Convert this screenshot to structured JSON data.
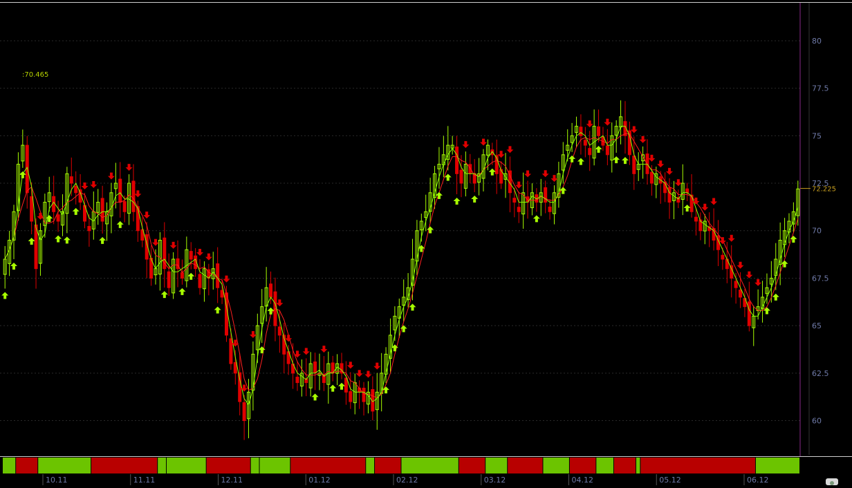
{
  "chart_data": {
    "type": "candlestick",
    "y_ticks": [
      "80",
      "77.5",
      "75",
      "72.5",
      "70",
      "67.5",
      "65",
      "62.5",
      "60"
    ],
    "ylim": [
      58.2,
      82.0
    ],
    "x_ticks": [
      "10.11",
      "11.11",
      "12.11",
      "01.12",
      "02.12",
      "03.12",
      "04.12",
      "05.12",
      "06.12"
    ],
    "last_price_label": "72.225",
    "last_price": 72.225,
    "marker_label": ":70.465",
    "grid": true,
    "series": [
      {
        "kind": "close",
        "values": [
          68.5,
          69.5,
          71.0,
          73.5,
          74.5,
          72.0,
          70.5,
          68.0,
          70.0,
          71.5,
          72.0,
          71.0,
          70.5,
          71.0,
          73.0,
          72.5,
          72.0,
          71.5,
          70.5,
          70.0,
          71.0,
          71.5,
          70.5,
          71.0,
          72.0,
          72.5,
          71.5,
          71.0,
          72.5,
          71.0,
          70.0,
          69.5,
          68.5,
          67.5,
          68.0,
          69.5,
          68.0,
          67.0,
          68.5,
          68.0,
          67.5,
          69.0,
          68.5,
          68.0,
          67.0,
          68.0,
          67.5,
          68.0,
          67.0,
          66.5,
          64.5,
          63.0,
          62.5,
          61.0,
          60.0,
          61.5,
          63.5,
          65.0,
          66.0,
          67.0,
          66.5,
          65.0,
          64.5,
          63.5,
          63.0,
          62.5,
          62.0,
          62.5,
          62.0,
          63.0,
          62.5,
          62.5,
          62.0,
          63.0,
          62.5,
          63.0,
          62.5,
          61.5,
          61.0,
          62.0,
          61.5,
          61.0,
          61.5,
          60.5,
          61.5,
          62.5,
          63.5,
          64.5,
          65.5,
          66.0,
          66.5,
          67.0,
          68.5,
          70.0,
          70.5,
          71.0,
          72.0,
          73.0,
          73.5,
          74.0,
          74.5,
          74.5,
          73.0,
          72.5,
          73.5,
          73.0,
          72.5,
          73.0,
          74.0,
          74.5,
          74.0,
          73.0,
          72.5,
          73.0,
          72.0,
          71.5,
          71.0,
          72.0,
          71.5,
          72.0,
          71.5,
          72.0,
          71.5,
          71.0,
          72.0,
          73.0,
          74.0,
          74.5,
          75.0,
          75.5,
          75.0,
          74.5,
          74.0,
          75.5,
          75.0,
          74.5,
          74.0,
          75.0,
          75.5,
          76.0,
          75.0,
          74.0,
          73.0,
          73.5,
          74.0,
          73.0,
          72.5,
          73.0,
          72.5,
          72.0,
          71.5,
          72.0,
          71.5,
          72.5,
          72.0,
          71.0,
          70.5,
          70.0,
          70.5,
          70.0,
          69.5,
          69.0,
          68.5,
          68.0,
          67.5,
          67.0,
          66.5,
          66.0,
          65.0,
          65.5,
          66.0,
          66.5,
          67.0,
          67.5,
          68.5,
          69.5,
          70.0,
          70.5,
          71.0,
          72.2
        ]
      }
    ],
    "regime_bar": [
      {
        "from": 0,
        "to": 3,
        "state": "up"
      },
      {
        "from": 3,
        "to": 8,
        "state": "down"
      },
      {
        "from": 8,
        "to": 20,
        "state": "up"
      },
      {
        "from": 20,
        "to": 35,
        "state": "down"
      },
      {
        "from": 35,
        "to": 37,
        "state": "up"
      },
      {
        "from": 37,
        "to": 46,
        "state": "up"
      },
      {
        "from": 46,
        "to": 56,
        "state": "down"
      },
      {
        "from": 56,
        "to": 58,
        "state": "up"
      },
      {
        "from": 58,
        "to": 65,
        "state": "up"
      },
      {
        "from": 65,
        "to": 82,
        "state": "down"
      },
      {
        "from": 82,
        "to": 84,
        "state": "up"
      },
      {
        "from": 84,
        "to": 90,
        "state": "down"
      },
      {
        "from": 90,
        "to": 103,
        "state": "up"
      },
      {
        "from": 103,
        "to": 109,
        "state": "down"
      },
      {
        "from": 109,
        "to": 114,
        "state": "up"
      },
      {
        "from": 114,
        "to": 122,
        "state": "down"
      },
      {
        "from": 122,
        "to": 128,
        "state": "up"
      },
      {
        "from": 128,
        "to": 134,
        "state": "down"
      },
      {
        "from": 134,
        "to": 138,
        "state": "up"
      },
      {
        "from": 138,
        "to": 143,
        "state": "down"
      },
      {
        "from": 143,
        "to": 144,
        "state": "up"
      },
      {
        "from": 144,
        "to": 170,
        "state": "down"
      },
      {
        "from": 170,
        "to": 180,
        "state": "up"
      }
    ]
  },
  "colors": {
    "up": "#a8ff00",
    "down": "#e00000",
    "bar_up": "#6cc400",
    "bar_down": "#b80000",
    "grid": "#2a2a2a",
    "axis_text": "#6f7aa8",
    "separator": "#8a2a8a",
    "last_price": "#c9a020",
    "marker_text": "#b7d300"
  }
}
